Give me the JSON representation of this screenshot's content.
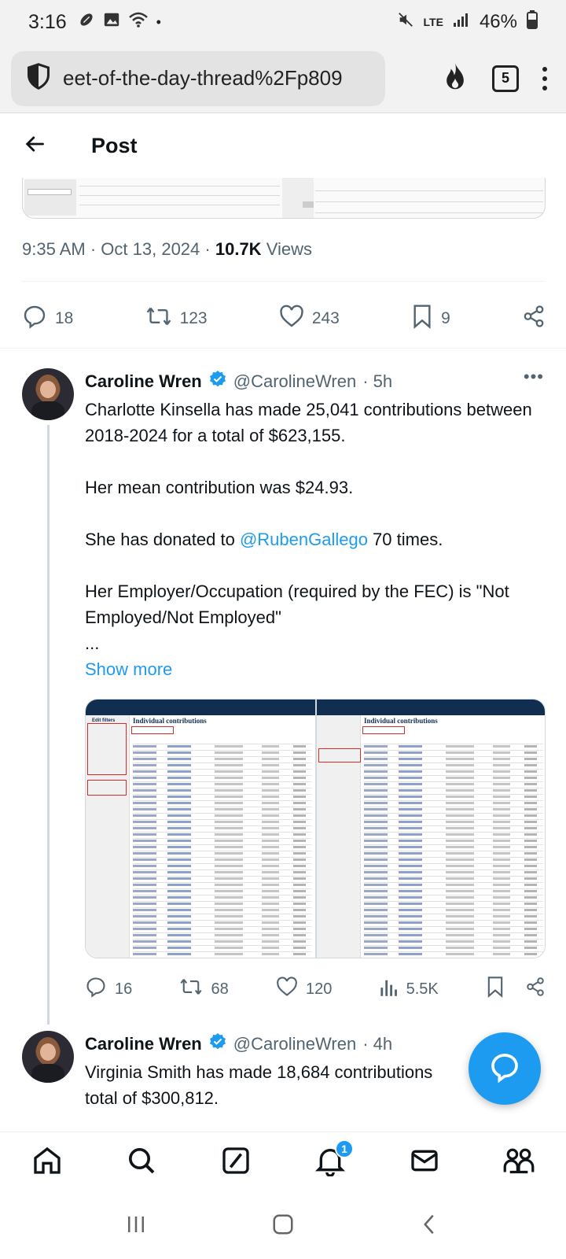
{
  "status_bar": {
    "time": "3:16",
    "network": "LTE",
    "battery": "46%"
  },
  "browser": {
    "url": "eet-of-the-day-thread%2Fp809",
    "tab_count": "5"
  },
  "header": {
    "title": "Post"
  },
  "main_post": {
    "time": "9:35 AM",
    "date": "Oct 13, 2024",
    "separator": "·",
    "views_count": "10.7K",
    "views_label": "Views",
    "replies": "18",
    "reposts": "123",
    "likes": "243",
    "bookmarks": "9"
  },
  "replies": [
    {
      "name": "Caroline Wren",
      "handle": "@CarolineWren",
      "age": "· 5h",
      "text_1": "Charlotte Kinsella has made 25,041 contributions between 2018-2024 for a total of $623,155.",
      "text_2": "Her mean contribution was $24.93.",
      "text_3_pre": "She has donated to ",
      "text_3_mention": "@RubenGallego",
      "text_3_post": " 70 times.",
      "text_4": "Her Employer/Occupation (required by the FEC) is \"Not Employed/Not Employed\"",
      "ellipsis": "...",
      "show_more": "Show more",
      "media_title_left": "Individual contributions",
      "media_title_right": "Individual contributions",
      "media_sidebar_label": "Edit filters",
      "replies": "16",
      "reposts": "68",
      "likes": "120",
      "views": "5.5K"
    },
    {
      "name": "Caroline Wren",
      "handle": "@CarolineWren",
      "age": "· 4h",
      "text_1": "Virginia Smith has made 18,684 contributions",
      "text_2": "total of $300,812."
    }
  ],
  "bottom_nav": {
    "notifications_badge": "1"
  },
  "colors": {
    "accent": "#1d9bf0",
    "text": "#0f1419",
    "secondary": "#536471"
  }
}
